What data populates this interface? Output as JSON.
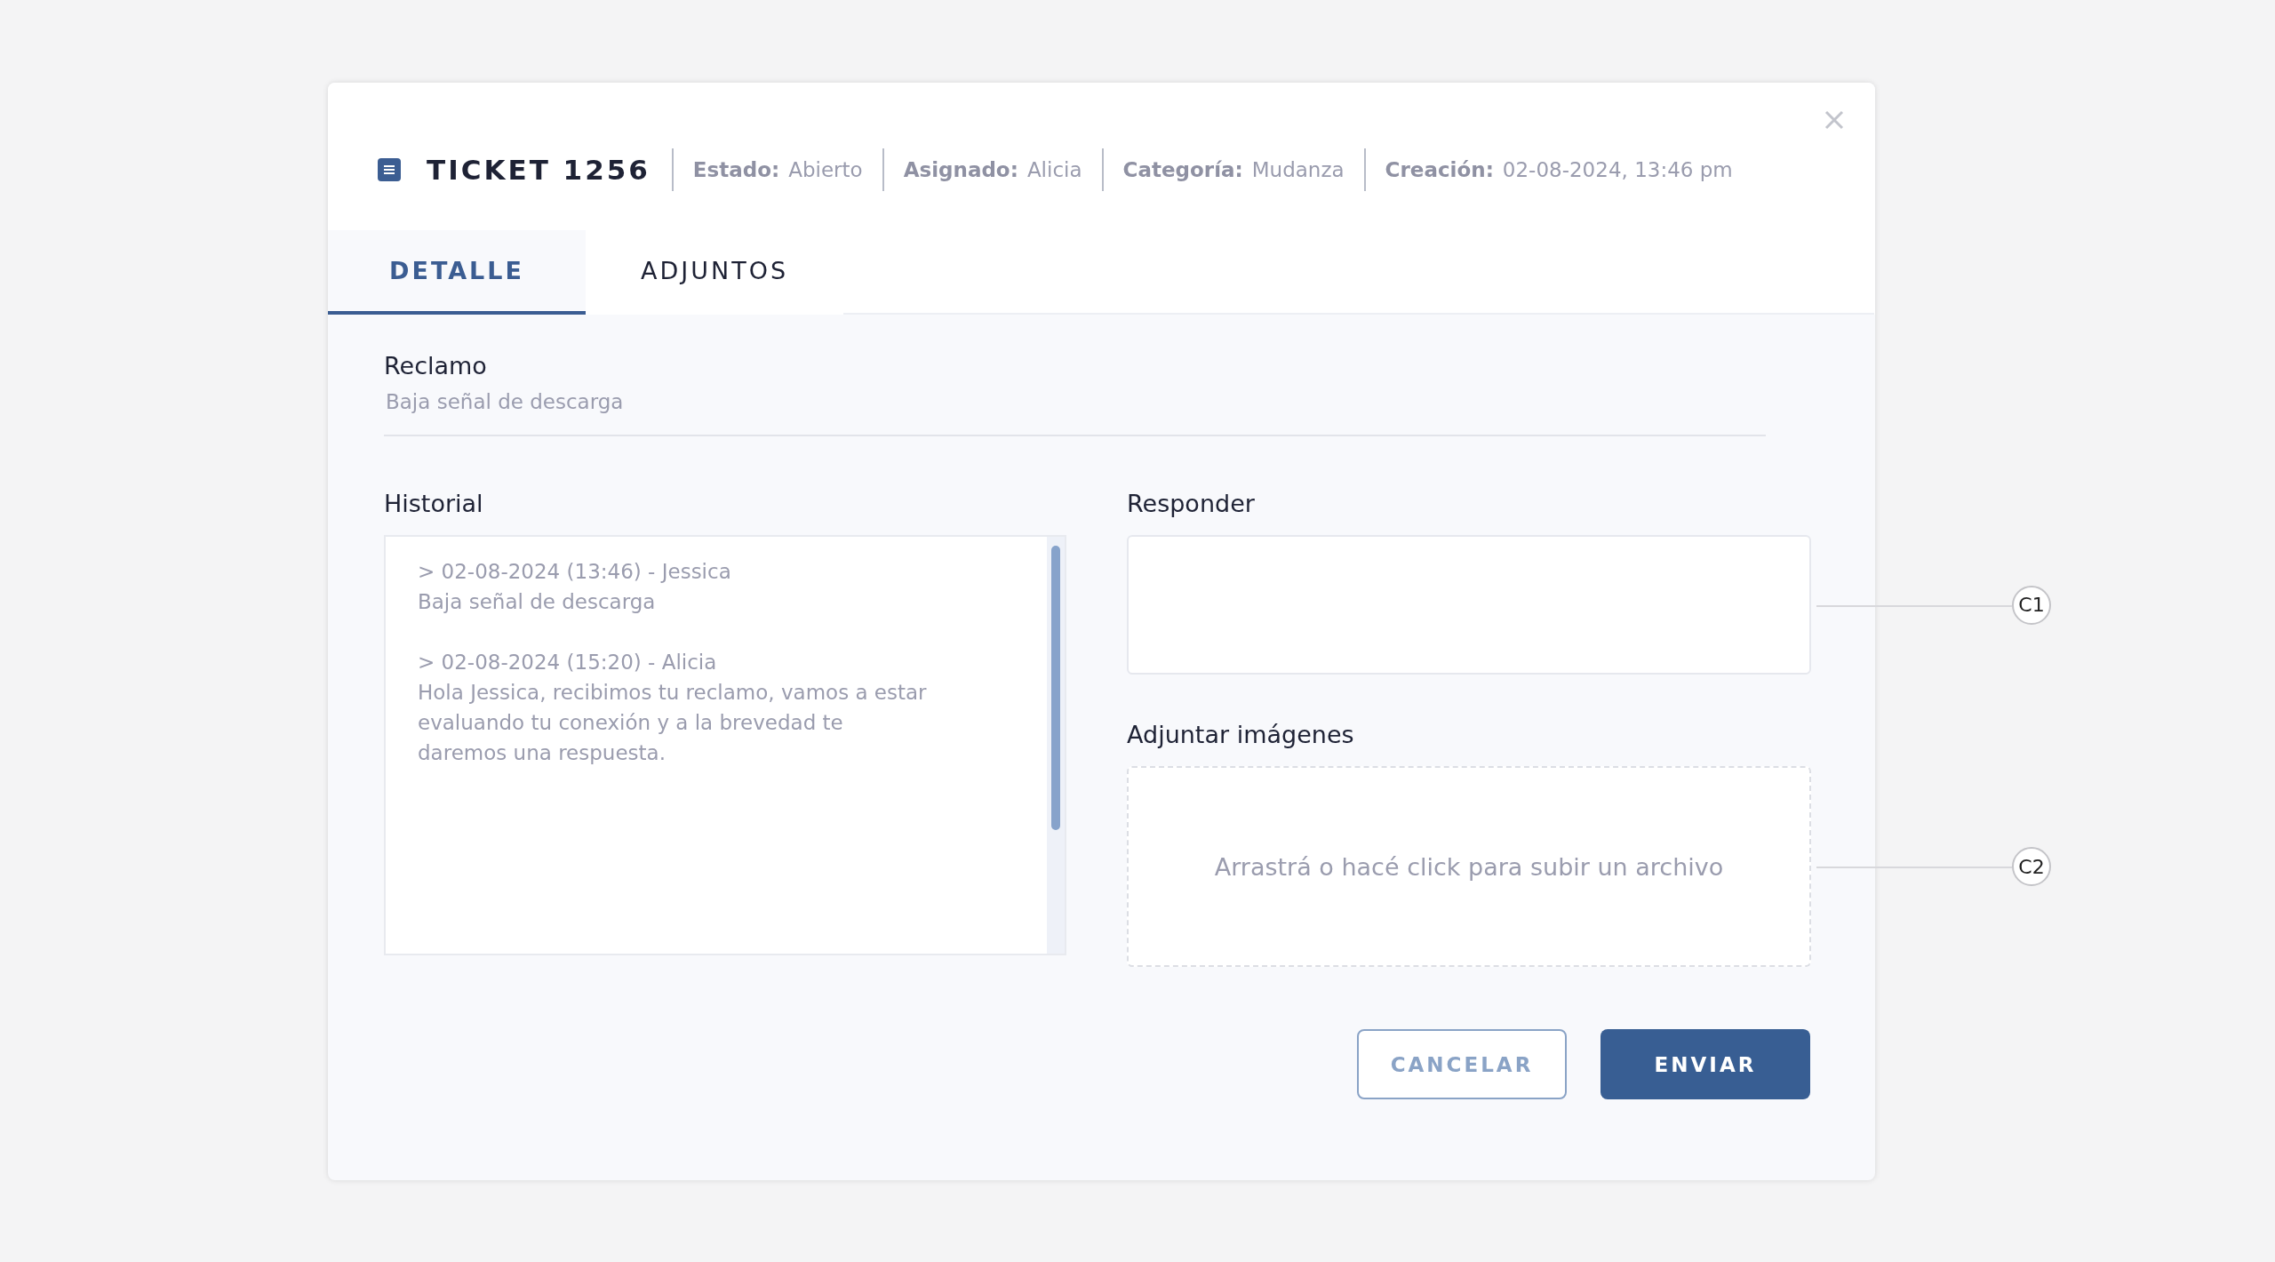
{
  "header": {
    "title": "TICKET 1256",
    "meta": [
      {
        "label": "Estado:",
        "value": "Abierto"
      },
      {
        "label": "Asignado:",
        "value": "Alicia"
      },
      {
        "label": "Categoría:",
        "value": "Mudanza"
      },
      {
        "label": "Creación:",
        "value": "02-08-2024, 13:46 pm"
      }
    ]
  },
  "tabs": [
    {
      "label": "DETALLE",
      "selected": true
    },
    {
      "label": "ADJUNTOS",
      "selected": false
    }
  ],
  "claim": {
    "label": "Reclamo",
    "value": "Baja señal de descarga"
  },
  "history": {
    "label": "Historial",
    "entries": [
      {
        "heading": "> 02-08-2024 (13:46) - Jessica",
        "text": "Baja señal de descarga"
      },
      {
        "heading": "> 02-08-2024 (15:20) - Alicia",
        "text": "Hola Jessica, recibimos tu reclamo, vamos a estar evaluando tu conexión y a la brevedad te daremos una respuesta."
      }
    ]
  },
  "reply": {
    "label": "Responder",
    "callout": "C1"
  },
  "attach": {
    "label": "Adjuntar imágenes",
    "placeholder": "Arrastrá o hacé click para subir un archivo",
    "callout": "C2"
  },
  "buttons": [
    {
      "label": "CANCELAR",
      "kind": "secondary"
    },
    {
      "label": "ENVIAR",
      "kind": "primary"
    }
  ]
}
